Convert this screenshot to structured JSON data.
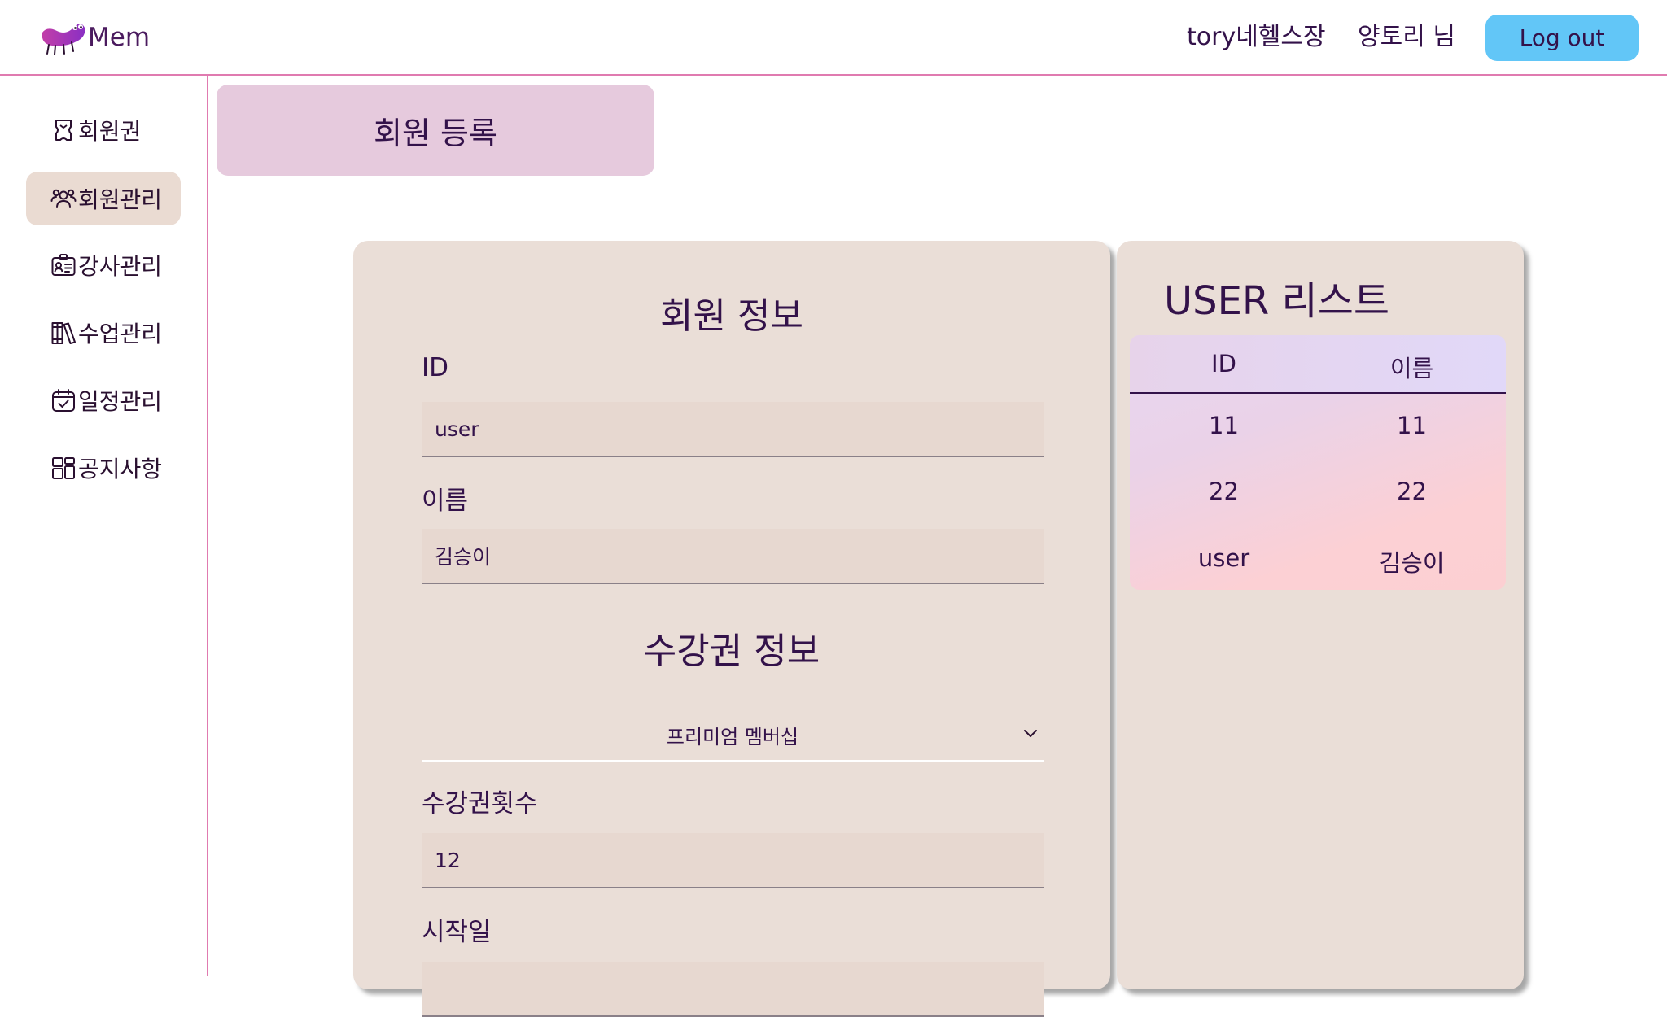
{
  "header": {
    "brand_name": "Mem",
    "club_name": "tory네헬스장",
    "user_name": "양토리 님",
    "logout_label": "Log out",
    "logout_color": "#62c6f7",
    "accent_line_color": "#e07bb0"
  },
  "sidebar": {
    "items": [
      {
        "label": "회원권",
        "icon": "ticket-icon",
        "active": false
      },
      {
        "label": "회원관리",
        "icon": "users-icon",
        "active": true
      },
      {
        "label": "강사관리",
        "icon": "id-badge-icon",
        "active": false
      },
      {
        "label": "수업관리",
        "icon": "books-icon",
        "active": false
      },
      {
        "label": "일정관리",
        "icon": "calendar-check-icon",
        "active": false
      },
      {
        "label": "공지사항",
        "icon": "layout-grid-icon",
        "active": false
      }
    ]
  },
  "page": {
    "title": "회원 등록"
  },
  "member_form": {
    "member_section_title": "회원 정보",
    "id_label": "ID",
    "id_value": "user",
    "name_label": "이름",
    "name_value": "김승이",
    "pass_section_title": "수강권 정보",
    "pass_type_value": "프리미엄 멤버십",
    "pass_count_label": "수강권횟수",
    "pass_count_value": "12",
    "start_date_label": "시작일"
  },
  "user_list": {
    "title": "USER 리스트",
    "columns": [
      "ID",
      "이름"
    ],
    "rows": [
      [
        "11",
        "11"
      ],
      [
        "22",
        "22"
      ],
      [
        "user",
        "김승이"
      ]
    ]
  }
}
